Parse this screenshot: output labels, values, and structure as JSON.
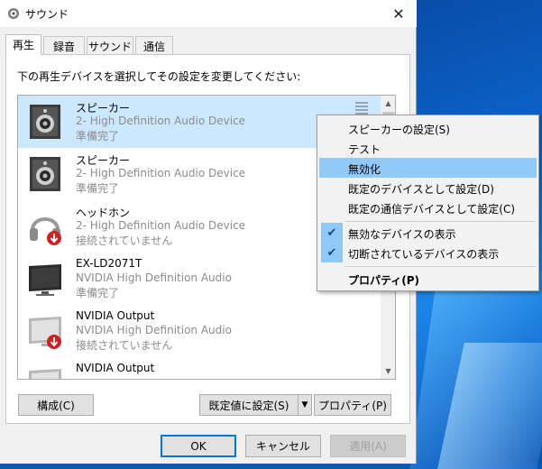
{
  "window": {
    "title": "サウンド",
    "close_glyph": "✕"
  },
  "tabs": [
    "再生",
    "録音",
    "サウンド",
    "通信"
  ],
  "instruction": "下の再生デバイスを選択してその設定を変更してください:",
  "devices": [
    {
      "name": "スピーカー",
      "desc": "2- High Definition Audio Device",
      "status": "準備完了",
      "icon": "speaker-icon"
    },
    {
      "name": "スピーカー",
      "desc": "2- High Definition Audio Device",
      "status": "準備完了",
      "icon": "speaker-icon"
    },
    {
      "name": "ヘッドホン",
      "desc": "2- High Definition Audio Device",
      "status": "接続されていません",
      "icon": "headphones-icon"
    },
    {
      "name": "EX-LD2071T",
      "desc": "NVIDIA High Definition Audio",
      "status": "準備完了",
      "icon": "monitor-icon"
    },
    {
      "name": "NVIDIA Output",
      "desc": "NVIDIA High Definition Audio",
      "status": "接続されていません",
      "icon": "monitor-icon"
    },
    {
      "name": "NVIDIA Output",
      "desc": "",
      "status": "",
      "icon": "monitor-icon"
    }
  ],
  "buttons": {
    "configure": "構成(C)",
    "set_default": "既定値に設定(S)",
    "properties": "プロパティ(P)",
    "ok": "OK",
    "cancel": "キャンセル",
    "apply": "適用(A)"
  },
  "context_menu": {
    "items": [
      {
        "label": "スピーカーの設定(S)",
        "checked": false,
        "highlight": false,
        "bold": false
      },
      {
        "label": "テスト",
        "checked": false,
        "highlight": false,
        "bold": false
      },
      {
        "label": "無効化",
        "checked": false,
        "highlight": true,
        "bold": false
      },
      {
        "label": "既定のデバイスとして設定(D)",
        "checked": false,
        "highlight": false,
        "bold": false
      },
      {
        "label": "既定の通信デバイスとして設定(C)",
        "checked": false,
        "highlight": false,
        "bold": false
      },
      {
        "label": "無効なデバイスの表示",
        "checked": true,
        "highlight": false,
        "bold": false
      },
      {
        "label": "切断されているデバイスの表示",
        "checked": true,
        "highlight": false,
        "bold": false
      },
      {
        "label": "プロパティ(P)",
        "checked": false,
        "highlight": false,
        "bold": true
      }
    ],
    "check_glyph": "✔"
  },
  "colors": {
    "selection": "#cce8ff",
    "menu_highlight": "#91c9f7",
    "accent": "#0078d7"
  }
}
